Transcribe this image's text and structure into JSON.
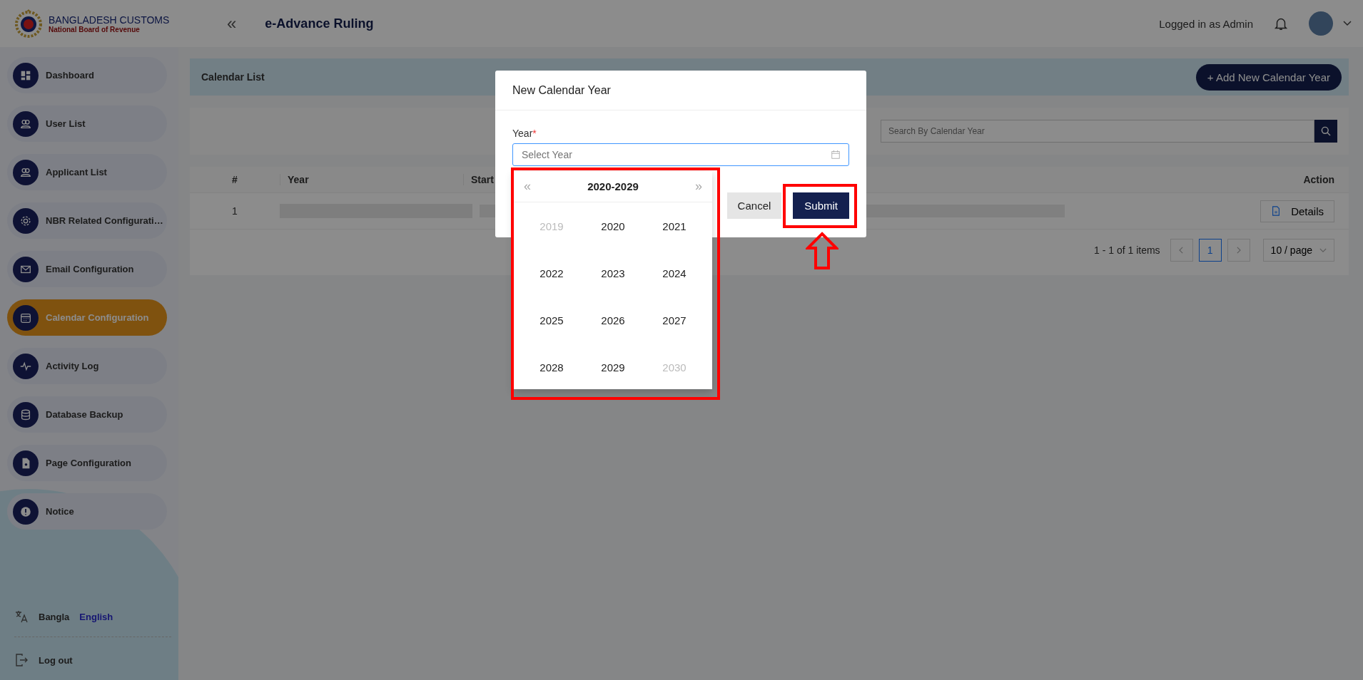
{
  "header": {
    "logo_title": "BANGLADESH CUSTOMS",
    "logo_subtitle": "National Board of Revenue",
    "collapse_glyph": "«",
    "app_title": "e-Advance Ruling",
    "user_label": "Logged in as Admin"
  },
  "sidebar": {
    "items": [
      {
        "label": "Dashboard",
        "selected": false
      },
      {
        "label": "User List",
        "selected": false
      },
      {
        "label": "Applicant List",
        "selected": false
      },
      {
        "label": "NBR Related Configurati…",
        "selected": false
      },
      {
        "label": "Email Configuration",
        "selected": false
      },
      {
        "label": "Calendar Configuration",
        "selected": true
      },
      {
        "label": "Activity Log",
        "selected": false
      },
      {
        "label": "Database Backup",
        "selected": false
      },
      {
        "label": "Page Configuration",
        "selected": false
      },
      {
        "label": "Notice",
        "selected": false
      }
    ],
    "languages": [
      {
        "label": "Bangla",
        "selected": false
      },
      {
        "label": "English",
        "selected": true
      }
    ],
    "logout": "Log out"
  },
  "page": {
    "title": "Calendar List",
    "add_button": "+ Add New Calendar Year",
    "search": {
      "placeholder": "Search By Calendar Year"
    },
    "table": {
      "columns": [
        "#",
        "Year",
        "Start",
        "Action"
      ],
      "rows": [
        {
          "number": "1",
          "action": "Details"
        }
      ]
    },
    "pagination": {
      "summary": "1 - 1 of 1 items",
      "pages": [
        {
          "label": "1",
          "selected": true
        }
      ],
      "page_size": "10 / page"
    }
  },
  "modal": {
    "title": "New Calendar Year",
    "field_label": "Year",
    "required_mark": "*",
    "placeholder": "Select Year",
    "cancel": "Cancel",
    "submit": "Submit",
    "picker": {
      "prev": "«",
      "next": "»",
      "range": "2020-2029",
      "years": [
        {
          "label": "2019",
          "outside": true
        },
        {
          "label": "2020",
          "outside": false
        },
        {
          "label": "2021",
          "outside": false
        },
        {
          "label": "2022",
          "outside": false
        },
        {
          "label": "2023",
          "outside": false
        },
        {
          "label": "2024",
          "outside": false
        },
        {
          "label": "2025",
          "outside": false
        },
        {
          "label": "2026",
          "outside": false
        },
        {
          "label": "2027",
          "outside": false
        },
        {
          "label": "2028",
          "outside": false
        },
        {
          "label": "2029",
          "outside": false
        },
        {
          "label": "2030",
          "outside": true
        }
      ]
    }
  }
}
